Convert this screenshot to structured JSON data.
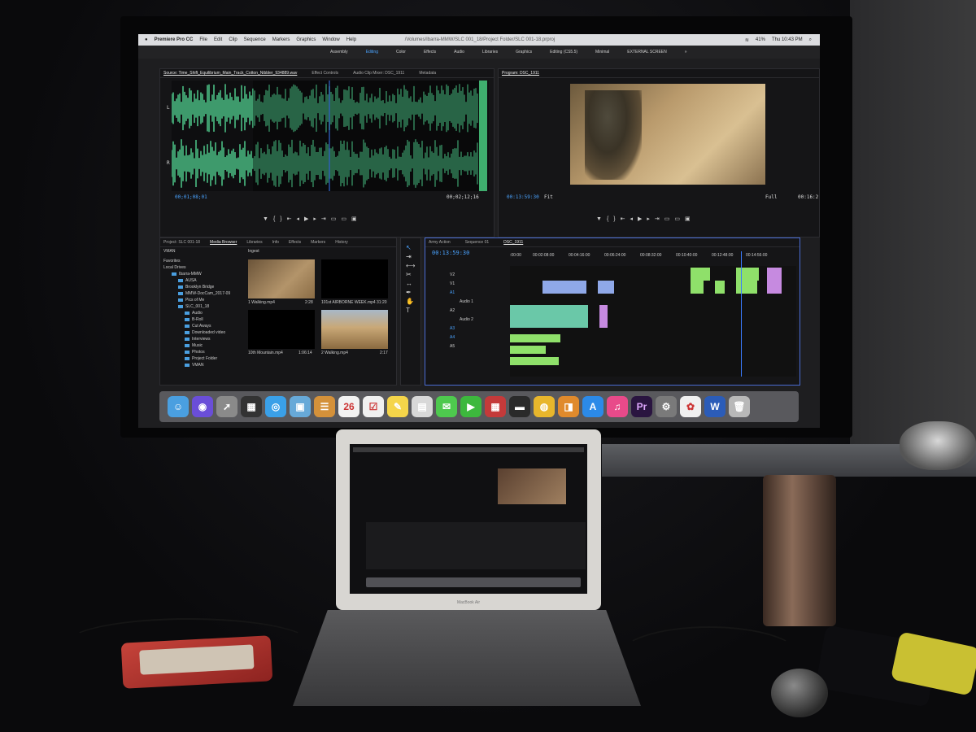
{
  "menubar": {
    "apple": "",
    "app": "Premiere Pro CC",
    "items": [
      "File",
      "Edit",
      "Clip",
      "Sequence",
      "Markers",
      "Graphics",
      "Window",
      "Help"
    ],
    "path": "/Volumes/Ibarra-MMW/SLC 001_18/Project Folder/SLC 001-18.prproj",
    "battery": "41%",
    "clock": "Thu 10:43 PM"
  },
  "workspaces": [
    "Assembly",
    "Editing",
    "Color",
    "Effects",
    "Audio",
    "Libraries",
    "Graphics",
    "Editing (CS5.5)",
    "Minimal",
    "EXTERNAL SCREEN",
    "»"
  ],
  "source": {
    "tabs": [
      "Source: Time_Shift_Equilibrium_Main_Track_Cotton_Nibbler_934889.wav",
      "Effect Controls",
      "Audio Clip Mixer: DSC_1911",
      "Metadata"
    ],
    "tc_in": "00;01;08;01",
    "tc_out": "00;02;12;16",
    "channels": [
      "L",
      "R"
    ]
  },
  "program": {
    "tab": "Program: DSC_1911",
    "tc": "00:13:59:30",
    "fit": "Fit",
    "full": "Full",
    "tc_out": "00:16:2"
  },
  "project": {
    "tabs": [
      "Project: SLC 001-18",
      "Media Browser",
      "Libraries",
      "Info",
      "Effects",
      "Markers",
      "History"
    ],
    "dropdown": "VMAN",
    "ingest": "Ingest",
    "tree": [
      "Favorites",
      "Local Drives",
      "Ibarra-MMW",
      "AUSA",
      "Brooklyn Bridge",
      "MMW-DocCam_2017-09",
      "Pics of Me",
      "SLC_001_18",
      "Audio",
      "B-Roll",
      "Cut Aways",
      "Downloaded video",
      "Interviews",
      "Music",
      "Photos",
      "Project Folder",
      "VMAN"
    ],
    "thumbs": [
      {
        "name": "1 Walking.mp4",
        "dur": "2:28"
      },
      {
        "name": "101st AIRBORNE WEEK.mp4",
        "dur": "31:20"
      },
      {
        "name": "10th Mountain.mp4",
        "dur": "1:06:14"
      },
      {
        "name": "2 Walking.mp4",
        "dur": "2:17"
      }
    ]
  },
  "timeline": {
    "tabs": [
      "Army Action",
      "Sequence 01",
      "DSC_1911"
    ],
    "tc": "00:13:59:30",
    "ruler": [
      ":00:00",
      "00:02:08:00",
      "00:04:16:00",
      "00:06:24:00",
      "00:08:32:00",
      "00:10:40:00",
      "00:12:48:00",
      "00:14:56:00"
    ],
    "tracks": [
      "V2",
      "V1",
      "A1",
      "Audio 1",
      "A2",
      "Audio 2",
      "A3",
      "A4",
      "A5"
    ]
  },
  "dock": [
    {
      "name": "finder-icon",
      "glyph": "☺",
      "color": "#4a9fe0"
    },
    {
      "name": "siri-icon",
      "glyph": "◉",
      "color": "#6a4ed8"
    },
    {
      "name": "launchpad-icon",
      "glyph": "➚",
      "color": "#8a8a8a"
    },
    {
      "name": "mission-control-icon",
      "glyph": "▦",
      "color": "#333333"
    },
    {
      "name": "safari-icon",
      "glyph": "◎",
      "color": "#3aa0e8"
    },
    {
      "name": "preview-icon",
      "glyph": "▣",
      "color": "#67a9d8"
    },
    {
      "name": "contacts-icon",
      "glyph": "☰",
      "color": "#d4913a"
    },
    {
      "name": "calendar-icon",
      "glyph": "26",
      "color": "#f2f2f2"
    },
    {
      "name": "reminders-icon",
      "glyph": "☑",
      "color": "#f0f0f0"
    },
    {
      "name": "notes-icon",
      "glyph": "✎",
      "color": "#f5d54a"
    },
    {
      "name": "photo-booth-icon",
      "glyph": "▤",
      "color": "#d8d8d8"
    },
    {
      "name": "messages-icon",
      "glyph": "✉",
      "color": "#4ec94e"
    },
    {
      "name": "facetime-icon",
      "glyph": "▶",
      "color": "#3db83d"
    },
    {
      "name": "photo-booth-alt-icon",
      "glyph": "▦",
      "color": "#c43a3a"
    },
    {
      "name": "drive-icon",
      "glyph": "▬",
      "color": "#2a2a2a"
    },
    {
      "name": "chrome-icon",
      "glyph": "◍",
      "color": "#e8b62c"
    },
    {
      "name": "ibooks-icon",
      "glyph": "◨",
      "color": "#e08a2c"
    },
    {
      "name": "app-store-icon",
      "glyph": "A",
      "color": "#2c8ae8"
    },
    {
      "name": "itunes-icon",
      "glyph": "♫",
      "color": "#e84a8a"
    },
    {
      "name": "premiere-icon",
      "glyph": "Pr",
      "color": "#2a1540"
    },
    {
      "name": "system-prefs-icon",
      "glyph": "⚙",
      "color": "#7a7a7a"
    },
    {
      "name": "photos-icon",
      "glyph": "✿",
      "color": "#f0f0f0"
    },
    {
      "name": "word-icon",
      "glyph": "W",
      "color": "#2b5cb8"
    },
    {
      "name": "trash-icon",
      "glyph": "🗑",
      "color": "#b8b8b8"
    }
  ],
  "laptop_brand": "MacBook Air"
}
